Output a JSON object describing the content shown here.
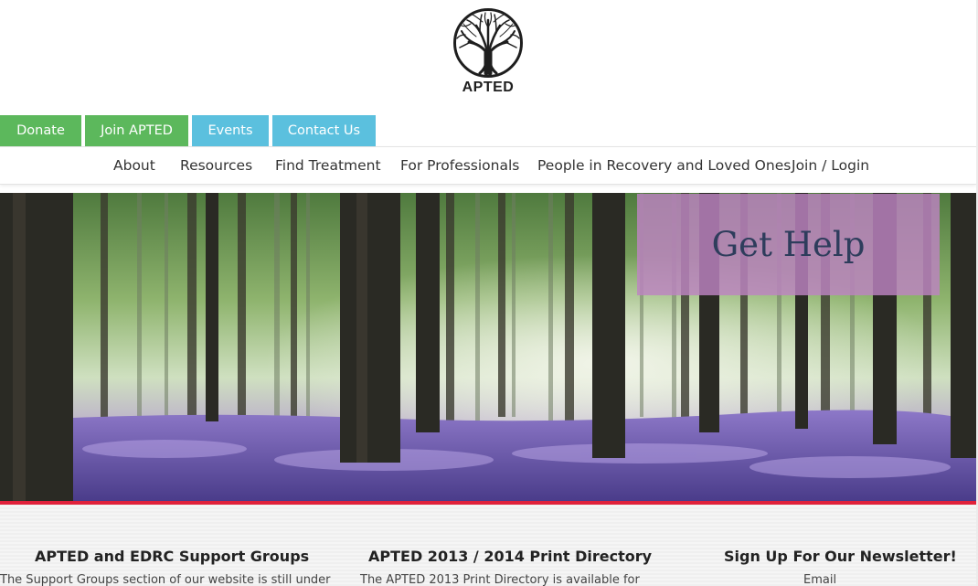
{
  "header": {
    "logo_text": "APTED",
    "logo_icon": "tree-icon"
  },
  "top_buttons": [
    {
      "label": "Donate",
      "color": "#5cb85c"
    },
    {
      "label": "Join APTED",
      "color": "#5cb85c"
    },
    {
      "label": "Events",
      "color": "#5bc0de"
    },
    {
      "label": "Contact Us",
      "color": "#5bc0de"
    }
  ],
  "nav": [
    {
      "label": "About"
    },
    {
      "label": "Resources"
    },
    {
      "label": "Find Treatment"
    },
    {
      "label": "For Professionals"
    },
    {
      "label": "People in Recovery and Loved Ones"
    },
    {
      "label": "Join / Login"
    }
  ],
  "hero": {
    "image": "bluebell-forest-photo",
    "cta_label": "Get Help",
    "cta_color": "#bd84c2",
    "accent_line_color": "#e0203a"
  },
  "columns": [
    {
      "title": "APTED and EDRC Support Groups",
      "text": "The Support Groups section of our website is still under"
    },
    {
      "title": "APTED 2013 / 2014 Print Directory",
      "text": "The APTED 2013 Print Directory is available for"
    },
    {
      "title": "Sign Up For Our Newsletter!",
      "text": "Email"
    }
  ]
}
